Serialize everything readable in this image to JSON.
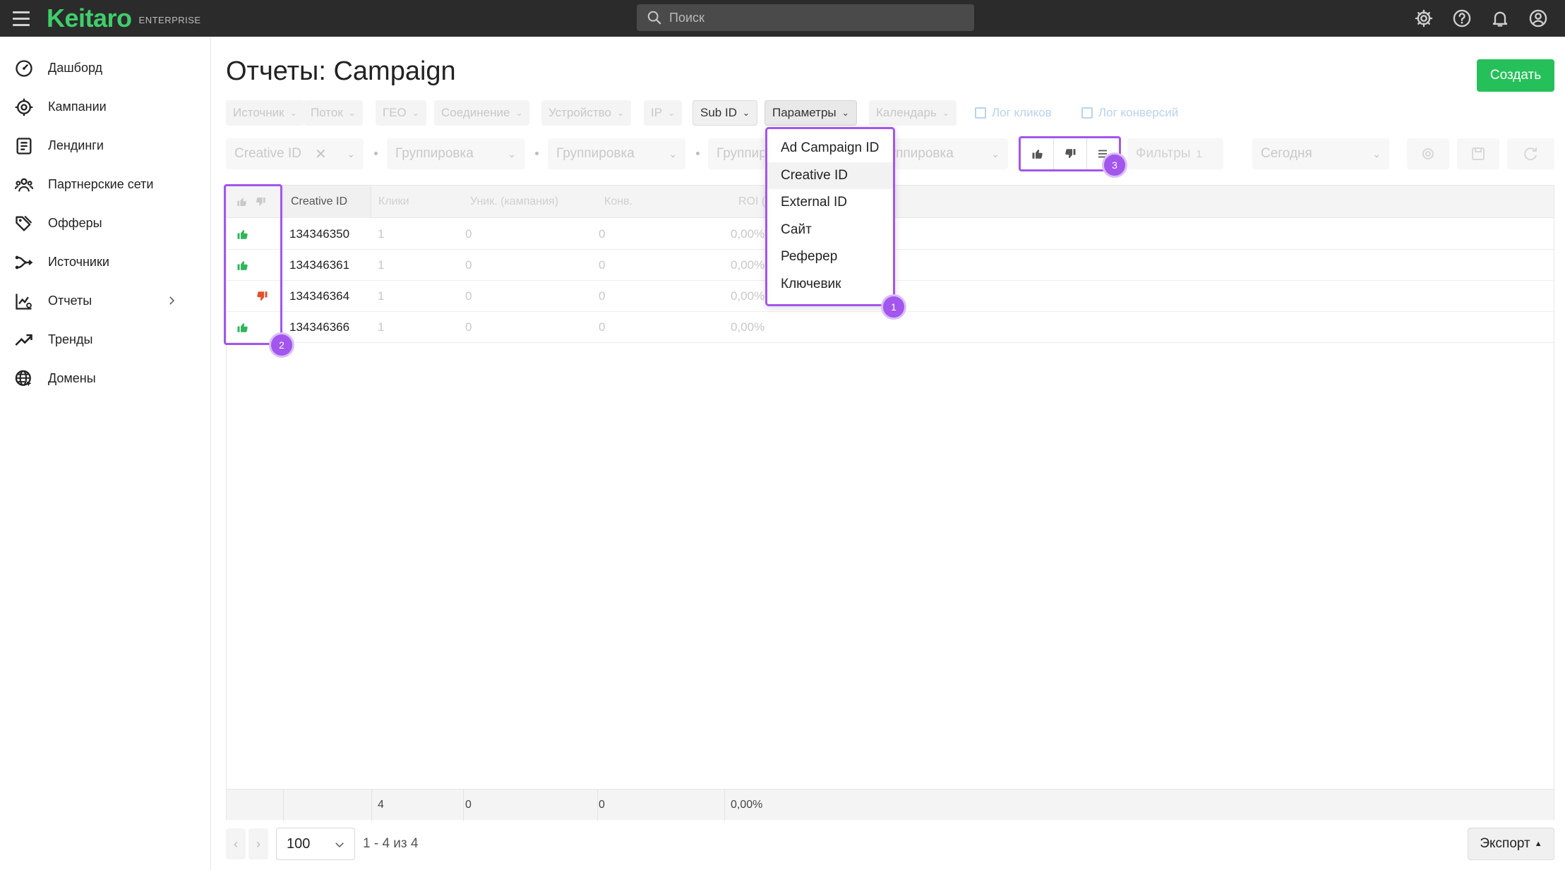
{
  "app": {
    "logo": "Keitaro",
    "edition": "ENTERPRISE",
    "search_placeholder": "Поиск"
  },
  "sidebar": {
    "items": [
      {
        "label": "Дашборд",
        "icon": "dashboard-icon"
      },
      {
        "label": "Кампании",
        "icon": "target-icon"
      },
      {
        "label": "Лендинги",
        "icon": "document-icon"
      },
      {
        "label": "Партнерские сети",
        "icon": "people-icon"
      },
      {
        "label": "Офферы",
        "icon": "tags-icon"
      },
      {
        "label": "Источники",
        "icon": "source-icon"
      },
      {
        "label": "Отчеты",
        "icon": "report-icon"
      },
      {
        "label": "Тренды",
        "icon": "trend-icon"
      },
      {
        "label": "Домены",
        "icon": "globe-icon"
      }
    ]
  },
  "page": {
    "title": "Отчеты: Campaign",
    "create_label": "Создать"
  },
  "param_chips": [
    {
      "label": "Источник"
    },
    {
      "label": "Поток"
    },
    {
      "label": "ГЕО"
    },
    {
      "label": "Соединение"
    },
    {
      "label": "Устройство"
    },
    {
      "label": "IP"
    },
    {
      "label": "Sub ID"
    },
    {
      "label": "Параметры"
    },
    {
      "label": "Календарь"
    }
  ],
  "links": {
    "click_log": "Лог кликов",
    "conversion_log": "Лог конверсий"
  },
  "grouping": {
    "first": "Creative ID",
    "placeholders": [
      "Группировка",
      "Группировка",
      "Группировка",
      "Группировка"
    ],
    "filters_label": "Фильтры",
    "filters_count": "1",
    "date_range": "Сегодня"
  },
  "dropdown": {
    "items": [
      "Ad Campaign ID",
      "Creative ID",
      "External ID",
      "Сайт",
      "Реферер",
      "Ключевик"
    ]
  },
  "badges": {
    "one": "1",
    "two": "2",
    "three": "3"
  },
  "table": {
    "columns": [
      "Creative ID",
      "Клики",
      "Уник. (кампания)",
      "Конв.",
      "ROI (к)"
    ],
    "rows": [
      {
        "vote": "up",
        "creative_id": "134346350",
        "clicks": "1",
        "uniq": "0",
        "conv": "0",
        "roi": "0,00%"
      },
      {
        "vote": "up",
        "creative_id": "134346361",
        "clicks": "1",
        "uniq": "0",
        "conv": "0",
        "roi": "0,00%"
      },
      {
        "vote": "down",
        "creative_id": "134346364",
        "clicks": "1",
        "uniq": "0",
        "conv": "0",
        "roi": "0,00%"
      },
      {
        "vote": "up",
        "creative_id": "134346366",
        "clicks": "1",
        "uniq": "0",
        "conv": "0",
        "roi": "0,00%"
      }
    ],
    "totals": {
      "clicks": "4",
      "uniq": "0",
      "conv": "0",
      "roi": "0,00%"
    }
  },
  "pagination": {
    "per_page": "100",
    "info": "1 - 4 из 4"
  },
  "export_label": "Экспорт",
  "colors": {
    "accent": "#26c05a",
    "highlight": "#a356ee",
    "thumb_up": "#2fb55a",
    "thumb_down": "#e5502b",
    "topbar": "#2b2b2b"
  }
}
